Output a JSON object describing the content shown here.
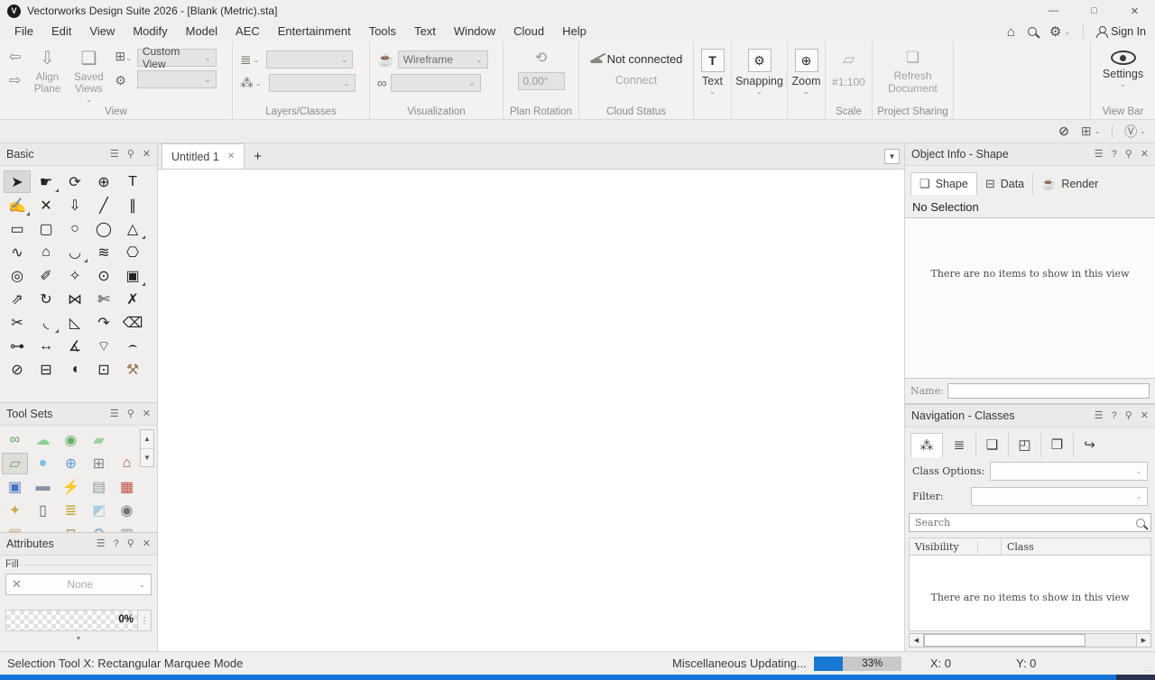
{
  "window": {
    "title": "Vectorworks Design Suite 2026 - [Blank (Metric).sta]"
  },
  "menu": {
    "items": [
      "File",
      "Edit",
      "View",
      "Modify",
      "Model",
      "AEC",
      "Entertainment",
      "Tools",
      "Text",
      "Window",
      "Cloud",
      "Help"
    ],
    "sign_in": "Sign In"
  },
  "toolbar": {
    "view": {
      "label": "View",
      "align_plane": "Align Plane",
      "saved_views": "Saved Views",
      "custom_view": "Custom View"
    },
    "layers_classes": {
      "label": "Layers/Classes"
    },
    "visualization": {
      "label": "Visualization",
      "render_mode": "Wireframe"
    },
    "plan_rotation": {
      "label": "Plan Rotation",
      "angle": "0.00°"
    },
    "cloud": {
      "label": "Cloud Status",
      "status": "Not connected",
      "connect": "Connect"
    },
    "text": {
      "label": "Text"
    },
    "snapping": {
      "label": "Snapping"
    },
    "zoom": {
      "label": "Zoom"
    },
    "scale": {
      "label": "Scale",
      "value": "#1:100"
    },
    "project_sharing": {
      "label": "Project Sharing",
      "refresh": "Refresh Document"
    },
    "view_bar": {
      "label": "View Bar",
      "settings": "Settings"
    }
  },
  "document": {
    "tab_label": "Untitled 1"
  },
  "palettes": {
    "basic": {
      "title": "Basic",
      "tools": [
        {
          "name": "selection-tool",
          "glyph": "➤",
          "selected": true
        },
        {
          "name": "pan-tool",
          "glyph": "☛",
          "flyout": true
        },
        {
          "name": "flyover-tool",
          "glyph": "⟳"
        },
        {
          "name": "zoom-tool",
          "glyph": "⊕"
        },
        {
          "name": "text-tool",
          "glyph": "T"
        },
        {
          "name": "callout-tool",
          "glyph": "✍",
          "flyout": true
        },
        {
          "name": "delete-tool",
          "glyph": "✕"
        },
        {
          "name": "send-to-surface-tool",
          "glyph": "⇩"
        },
        {
          "name": "line-tool",
          "glyph": "╱"
        },
        {
          "name": "double-line-tool",
          "glyph": "∥"
        },
        {
          "name": "rectangle-tool",
          "glyph": "▭"
        },
        {
          "name": "rounded-rectangle-tool",
          "glyph": "▢"
        },
        {
          "name": "circle-tool",
          "glyph": "○"
        },
        {
          "name": "oval-tool",
          "glyph": "◯"
        },
        {
          "name": "arc-tool",
          "glyph": "△",
          "flyout": true
        },
        {
          "name": "freehand-tool",
          "glyph": "∿"
        },
        {
          "name": "polygon-tool",
          "glyph": "⌂"
        },
        {
          "name": "polyline-tool",
          "glyph": "◡",
          "flyout": true
        },
        {
          "name": "surface-tool",
          "glyph": "≋"
        },
        {
          "name": "regular-polygon-tool",
          "glyph": "⎔"
        },
        {
          "name": "spiral-tool",
          "glyph": "◎"
        },
        {
          "name": "eyedropper-tool",
          "glyph": "✐"
        },
        {
          "name": "magic-wand-tool",
          "glyph": "✧"
        },
        {
          "name": "select-similar-tool",
          "glyph": "⊙"
        },
        {
          "name": "clip-tool",
          "glyph": "▣",
          "flyout": true
        },
        {
          "name": "move-by-points-tool",
          "glyph": "⇗"
        },
        {
          "name": "rotate-tool",
          "glyph": "↻"
        },
        {
          "name": "mirror-tool",
          "glyph": "⋈"
        },
        {
          "name": "trim-tool",
          "glyph": "✄"
        },
        {
          "name": "intersect-tool",
          "glyph": "✗"
        },
        {
          "name": "split-tool",
          "glyph": "✂"
        },
        {
          "name": "fillet-tool",
          "glyph": "◟",
          "flyout": true
        },
        {
          "name": "chamfer-tool",
          "glyph": "◺"
        },
        {
          "name": "extend-tool",
          "glyph": "↷"
        },
        {
          "name": "eraser-tool",
          "glyph": "⌫"
        },
        {
          "name": "connect-combine-tool",
          "glyph": "⊶"
        },
        {
          "name": "dimension-tool",
          "glyph": "↔"
        },
        {
          "name": "angle-dimension-tool",
          "glyph": "∡"
        },
        {
          "name": "radial-dimension-tool",
          "glyph": "⌔"
        },
        {
          "name": "arc-dimension-tool",
          "glyph": "⌢"
        },
        {
          "name": "diameter-dimension-tool",
          "glyph": "⊘"
        },
        {
          "name": "tape-measure-tool",
          "glyph": "⊟"
        },
        {
          "name": "protractor-tool",
          "glyph": "◖"
        },
        {
          "name": "stamp-tool",
          "glyph": "⊡"
        },
        {
          "name": "attribute-mapping-tool",
          "glyph": "⚒",
          "color": "#9a7b4f"
        }
      ]
    },
    "tool_sets": {
      "title": "Tool Sets",
      "tools": [
        {
          "name": "toolset-connect-nodes",
          "glyph": "∞",
          "color": "#5aa05a"
        },
        {
          "name": "toolset-massing-cloud",
          "glyph": "☁",
          "color": "#8fcf96"
        },
        {
          "name": "toolset-site-marker",
          "glyph": "◉",
          "color": "#6ab06a"
        },
        {
          "name": "toolset-roadway",
          "glyph": "▰",
          "color": "#9fd0a0"
        },
        {
          "name": "toolset-video-screen",
          "glyph": "▱",
          "color": "#6aa86a",
          "selected": true
        },
        {
          "name": "toolset-water-drop",
          "glyph": "●",
          "color": "#7fc0e8"
        },
        {
          "name": "toolset-globe",
          "glyph": "⊕",
          "color": "#5b9bd5"
        },
        {
          "name": "toolset-cabinet-panel",
          "glyph": "⊞",
          "color": "#86837f"
        },
        {
          "name": "toolset-barn",
          "glyph": "⌂",
          "color": "#c05048"
        },
        {
          "name": "toolset-av-monitor",
          "glyph": "▣",
          "color": "#4a72c4"
        },
        {
          "name": "toolset-flashlight",
          "glyph": "▬",
          "color": "#8890a8"
        },
        {
          "name": "toolset-power-connector",
          "glyph": "⚡",
          "color": "#d8a83c"
        },
        {
          "name": "toolset-stage-deck",
          "glyph": "▤",
          "color": "#9098a0"
        },
        {
          "name": "toolset-curtain",
          "glyph": "▦",
          "color": "#c05048"
        },
        {
          "name": "toolset-work-light",
          "glyph": "✦",
          "color": "#c8a850"
        },
        {
          "name": "toolset-speaker",
          "glyph": "▯",
          "color": "#606068"
        },
        {
          "name": "toolset-cable-bundle",
          "glyph": "≣",
          "color": "#c8a83c"
        },
        {
          "name": "toolset-window-glass",
          "glyph": "◩",
          "color": "#a8cce0"
        },
        {
          "name": "toolset-camera",
          "glyph": "◉",
          "color": "#707078"
        },
        {
          "name": "toolset-crate",
          "glyph": "▤",
          "color": "#c8a878"
        },
        {
          "name": "toolset-bench",
          "glyph": "▬",
          "color": "#c8a878"
        },
        {
          "name": "toolset-table",
          "glyph": "⊓",
          "color": "#b09868"
        },
        {
          "name": "toolset-machinery",
          "glyph": "⚙",
          "color": "#80a8c8"
        },
        {
          "name": "toolset-piping",
          "glyph": "▥",
          "color": "#9098a0"
        }
      ]
    },
    "attributes": {
      "title": "Attributes",
      "fill_label": "Fill",
      "fill_value": "None",
      "opacity_value": "0%"
    }
  },
  "object_info": {
    "title": "Object Info - Shape",
    "tabs": [
      {
        "label": "Shape",
        "icon": "❑"
      },
      {
        "label": "Data",
        "icon": "⊟"
      },
      {
        "label": "Render",
        "icon": "☕"
      }
    ],
    "selection_status": "No Selection",
    "empty_message": "There are no items to show in this view",
    "name_label": "Name:"
  },
  "navigation": {
    "title": "Navigation - Classes",
    "tabs": [
      {
        "name": "classes",
        "glyph": "⁂",
        "active": true
      },
      {
        "name": "design-layers",
        "glyph": "≣"
      },
      {
        "name": "sheet-layers",
        "glyph": "❏"
      },
      {
        "name": "viewports",
        "glyph": "◰"
      },
      {
        "name": "saved-views",
        "glyph": "❐"
      },
      {
        "name": "references",
        "glyph": "↪"
      }
    ],
    "class_options_label": "Class Options:",
    "filter_label": "Filter:",
    "search_placeholder": "Search",
    "col_visibility": "Visibility",
    "col_class": "Class",
    "empty_message": "There are no items to show in this view"
  },
  "status_bar": {
    "tool_message": "Selection Tool X: Rectangular Marquee Mode",
    "updating_label": "Miscellaneous Updating...",
    "progress_value": 33,
    "progress_percent": "33%",
    "coord_x": "X: 0",
    "coord_y": "Y: 0"
  },
  "icons": {
    "logo_letter": "V",
    "minimize": "—",
    "maximize": "□",
    "close": "✕",
    "home": "⌂",
    "gear": "⚙",
    "chevron_down": "⌄",
    "back": "⇦",
    "forward": "⇨",
    "align_plane": "⇩",
    "saved_views_doc": "❏",
    "view_grid": "⊞",
    "cube_gear": "⚙",
    "layers": "≣",
    "classes": "⁂",
    "teapot": "☕",
    "glasses": "∞",
    "plan_rotation": "⟲",
    "cloud": "☁",
    "text_T": "T",
    "snap_gear": "⚙",
    "zoom_mag": "⊕",
    "ruler": "▱",
    "share_doc": "❏",
    "hamburger": "☰",
    "pin": "⚲",
    "help": "?",
    "close_small": "✕",
    "plus": "+",
    "tab_menu_arrow": "▼",
    "scroll_up": "▲",
    "scroll_down": "▼",
    "scroll_left": "◀",
    "scroll_right": "▶",
    "dots_vertical": "⋮",
    "expander_down": "▼",
    "none_x": "✕",
    "slashed_planet": "⊘",
    "frame_add": "⊞",
    "v_badge": "Ⓥ"
  },
  "colors": {
    "accent_blue": "#1879d2",
    "bottom_strip_blue": "#1373d6",
    "bottom_strip_dark": "#27324d",
    "chrome": "#f0efed",
    "panel": "#f1efed",
    "selected_tool": "#d9d9d9"
  }
}
